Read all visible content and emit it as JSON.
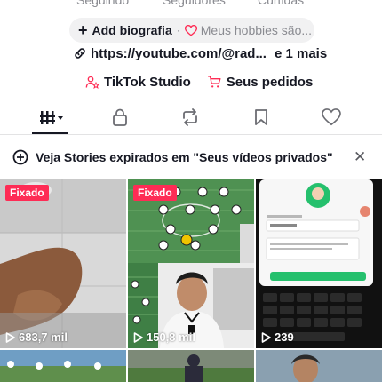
{
  "profile_stats": {
    "following_label": "Seguindo",
    "followers_label": "Seguidores",
    "likes_label": "Curtidas"
  },
  "bio": {
    "add_label": "Add biografia",
    "separator": "·",
    "hobby_placeholder": "Meus hobbies são..."
  },
  "link": {
    "url": "https://youtube.com/@rad...",
    "more": "e 1 mais"
  },
  "actions": {
    "studio_label": "TikTok Studio",
    "orders_label": "Seus pedidos"
  },
  "notice": {
    "text": "Veja Stories expirados em \"Seus vídeos privados\""
  },
  "videos": [
    {
      "pinned_label": "Fixado",
      "views": "683,7 mil"
    },
    {
      "pinned_label": "Fixado",
      "views": "150,8 mil"
    },
    {
      "views": "239"
    }
  ],
  "colors": {
    "accent": "#fe2c55",
    "text": "#161823",
    "muted": "#8a8b91"
  }
}
